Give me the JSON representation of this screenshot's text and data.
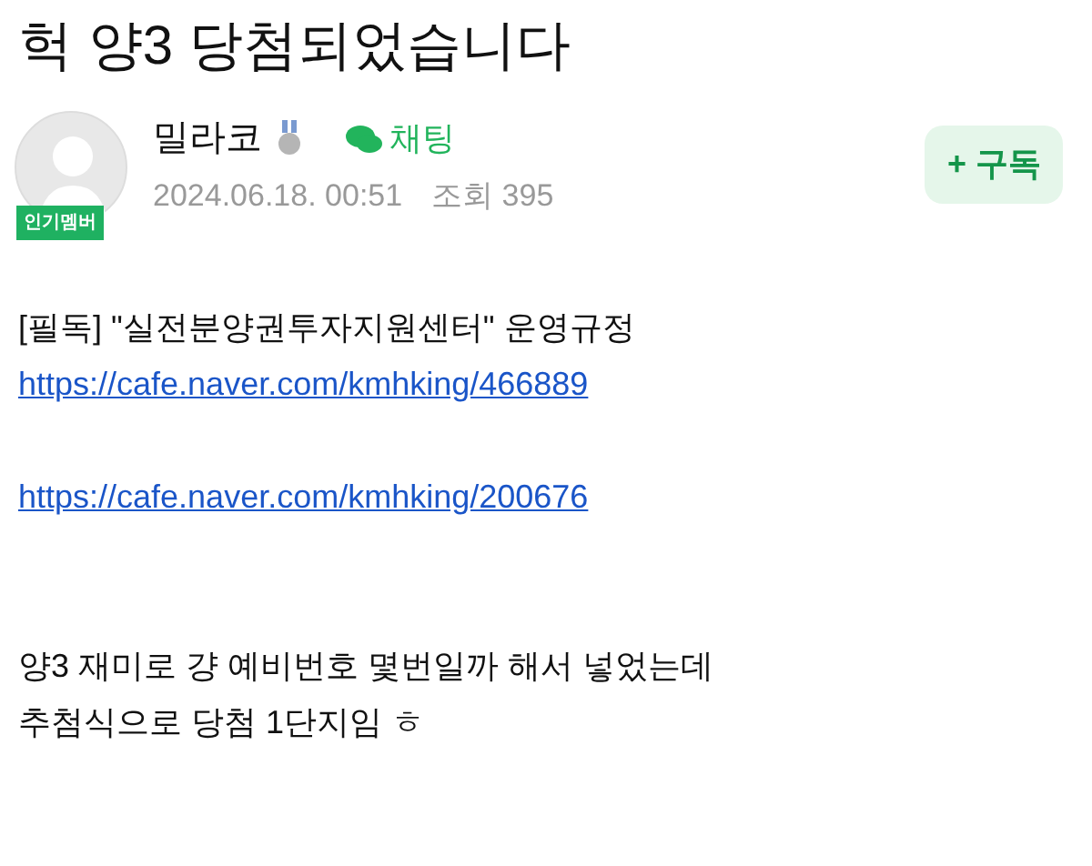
{
  "post": {
    "title": "헉 양3 당첨되었습니다"
  },
  "author": {
    "name": "밀라코",
    "badge": "인기멤버",
    "chat": "채팅",
    "date": "2024.06.18. 00:51",
    "views": "조회 395"
  },
  "subscribe_button": "+ 구독",
  "body": [
    {
      "kind": "text",
      "text": "[필독] \"실전분양권투자지원센터\" 운영규정"
    },
    {
      "kind": "link",
      "text": "https://cafe.naver.com/kmhking/466889"
    },
    {
      "kind": "gap"
    },
    {
      "kind": "link",
      "text": "https://cafe.naver.com/kmhking/200676"
    },
    {
      "kind": "gap"
    },
    {
      "kind": "gap"
    },
    {
      "kind": "text",
      "text": "양3 재미로 걍 예비번호 몇번일까 해서 넣었는데"
    },
    {
      "kind": "text",
      "text": "추첨식으로 당첨 1단지임 ㅎ"
    }
  ]
}
